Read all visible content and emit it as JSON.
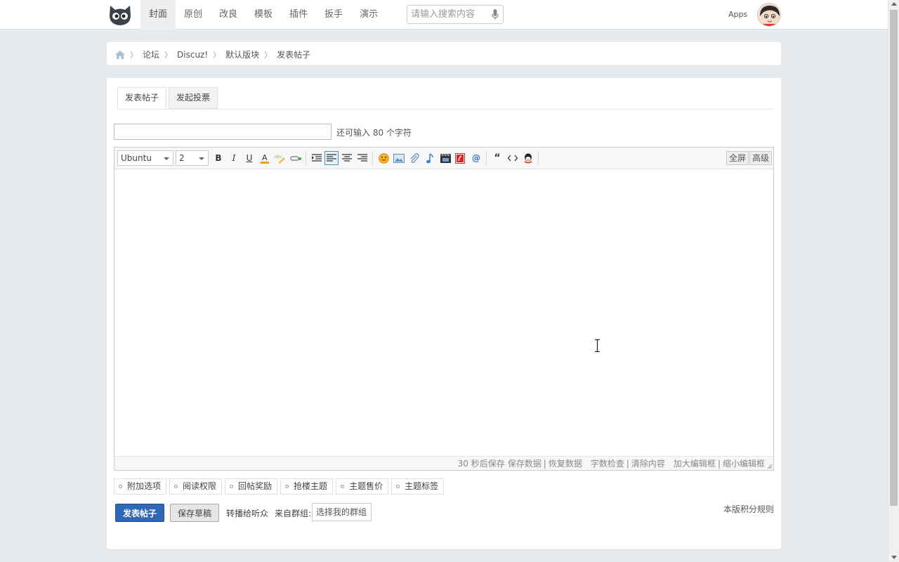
{
  "nav": {
    "items": [
      "封面",
      "原创",
      "改良",
      "模板",
      "插件",
      "扳手",
      "演示"
    ],
    "active_index": 0
  },
  "search": {
    "placeholder": "请输入搜索内容"
  },
  "header": {
    "apps_label": "Apps"
  },
  "breadcrumb": {
    "items": [
      "论坛",
      "Discuz!",
      "默认版块",
      "发表帖子"
    ]
  },
  "tabs": [
    "发表帖子",
    "发起投票"
  ],
  "title_field": {
    "value": "",
    "hint": "还可输入 80 个字符"
  },
  "editor": {
    "font_family": "Ubuntu",
    "font_size": "2",
    "fullscreen_label": "全屏",
    "advanced_label": "高级",
    "status": {
      "autosave": "30 秒后保存",
      "save_data": "保存数据",
      "restore_data": "恢复数据",
      "word_check": "字数检查",
      "clear": "清除内容",
      "enlarge": "加大编辑框",
      "shrink": "缩小编辑框",
      "separator": "|"
    }
  },
  "options": [
    "附加选项",
    "阅读权限",
    "回帖奖励",
    "抢楼主题",
    "主题售价",
    "主题标签"
  ],
  "actions": {
    "submit_label": "发表帖子",
    "draft_label": "保存草稿",
    "broadcast_label": "转播给听众",
    "from_group_label": "来自群组:",
    "group_select_value": "选择我的群组",
    "rules_label": "本版积分规则"
  },
  "colors": {
    "primary_button": "#2f67b8",
    "page_bg": "#e8ebed"
  }
}
